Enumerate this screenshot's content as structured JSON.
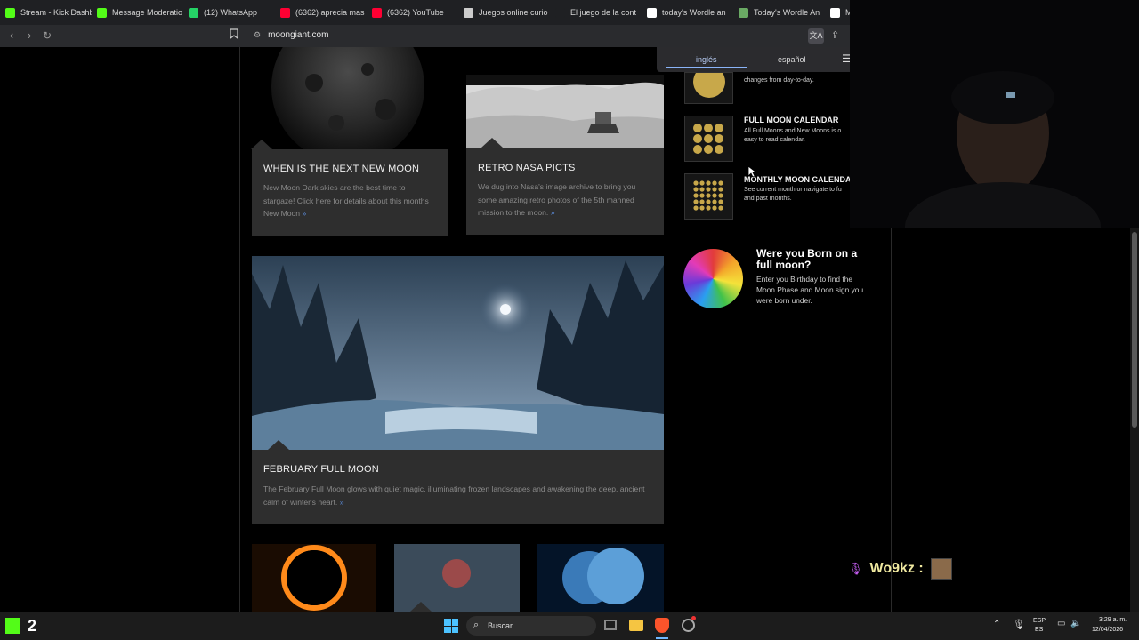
{
  "browser": {
    "tabs": [
      {
        "label": "Stream - Kick Dashb",
        "icon_color": "#53fc18",
        "icon": "kick-icon"
      },
      {
        "label": "Message Moderatio",
        "icon_color": "#53fc18",
        "icon": "kick-icon"
      },
      {
        "label": "(12) WhatsApp",
        "icon_color": "#25d366",
        "icon": "whatsapp-icon"
      },
      {
        "label": "(6362) aprecia mas",
        "icon_color": "#ff0033",
        "icon": "youtube-icon"
      },
      {
        "label": "(6362) YouTube",
        "icon_color": "#ff0033",
        "icon": "youtube-icon"
      },
      {
        "label": "Juegos online curio",
        "icon_color": "#cccccc",
        "icon": "site-icon"
      },
      {
        "label": "El juego de la cont",
        "icon_color": "#1f2023",
        "icon": "site-icon"
      },
      {
        "label": "today's Wordle an",
        "icon_color": "#ffffff",
        "icon": "google-icon"
      },
      {
        "label": "Today's Wordle An",
        "icon_color": "#6aaa64",
        "icon": "wordle-icon"
      },
      {
        "label": "Mo",
        "icon_color": "#ffffff",
        "icon": "google-icon"
      }
    ],
    "url": "moongiant.com",
    "translate": {
      "lang1": "inglés",
      "lang2": "español"
    }
  },
  "cards": {
    "newmoon": {
      "title": "WHEN IS THE NEXT NEW MOON",
      "text": "New Moon Dark skies are the best time to stargaze! Click here for details about this months New Moon",
      "more": "»"
    },
    "nasa": {
      "title": "RETRO NASA PICTS",
      "text": "We dug into Nasa's image archive to bring you some amazing retro photos of the 5th manned mission to the moon.",
      "more": "»"
    },
    "february": {
      "title": "FEBRUARY FULL MOON",
      "text": "The February Full Moon glows with quiet magic, illuminating frozen landscapes and awakening the deep, ancient calm of winter's heart.",
      "more": "»"
    }
  },
  "sidebar": {
    "item0_desc": "changes from day-to-day.",
    "item1": {
      "title": "FULL MOON CALENDAR",
      "desc": "All Full Moons and New Moons is o easy to read calendar."
    },
    "item2": {
      "title": "MONTHLY MOON CALENDAR",
      "desc": "See current month or navigate to fu and past months."
    },
    "born": {
      "title": "Were you Born on a full moon?",
      "desc": "Enter you Birthday to find the Moon Phase and Moon sign you were born under."
    }
  },
  "overlay": {
    "chat_user": "Wo9kz :",
    "kick_count": "2"
  },
  "taskbar": {
    "search_placeholder": "Buscar",
    "lang_top": "ESP",
    "lang_bottom": "ES",
    "time": "3:29 a. m.",
    "date": "12/04/2026"
  }
}
